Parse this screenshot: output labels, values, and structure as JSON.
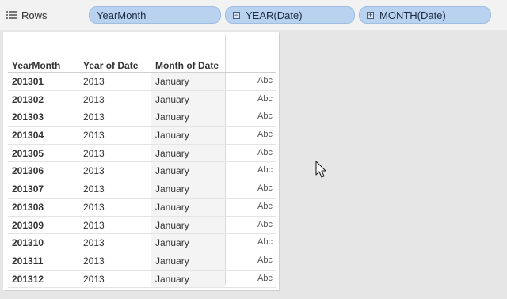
{
  "shelf": {
    "label": "Rows",
    "pills": [
      {
        "label": "YearMonth",
        "toggle": ""
      },
      {
        "label": "YEAR(Date)",
        "toggle": "−"
      },
      {
        "label": "MONTH(Date)",
        "toggle": "+"
      }
    ]
  },
  "table": {
    "columns": [
      "YearMonth",
      "Year of Date",
      "Month of Date"
    ],
    "rows": [
      {
        "yearmonth": "201301",
        "year": "2013",
        "month": "January",
        "value": "Abc"
      },
      {
        "yearmonth": "201302",
        "year": "2013",
        "month": "January",
        "value": "Abc"
      },
      {
        "yearmonth": "201303",
        "year": "2013",
        "month": "January",
        "value": "Abc"
      },
      {
        "yearmonth": "201304",
        "year": "2013",
        "month": "January",
        "value": "Abc"
      },
      {
        "yearmonth": "201305",
        "year": "2013",
        "month": "January",
        "value": "Abc"
      },
      {
        "yearmonth": "201306",
        "year": "2013",
        "month": "January",
        "value": "Abc"
      },
      {
        "yearmonth": "201307",
        "year": "2013",
        "month": "January",
        "value": "Abc"
      },
      {
        "yearmonth": "201308",
        "year": "2013",
        "month": "January",
        "value": "Abc"
      },
      {
        "yearmonth": "201309",
        "year": "2013",
        "month": "January",
        "value": "Abc"
      },
      {
        "yearmonth": "201310",
        "year": "2013",
        "month": "January",
        "value": "Abc"
      },
      {
        "yearmonth": "201311",
        "year": "2013",
        "month": "January",
        "value": "Abc"
      },
      {
        "yearmonth": "201312",
        "year": "2013",
        "month": "January",
        "value": "Abc"
      }
    ]
  }
}
